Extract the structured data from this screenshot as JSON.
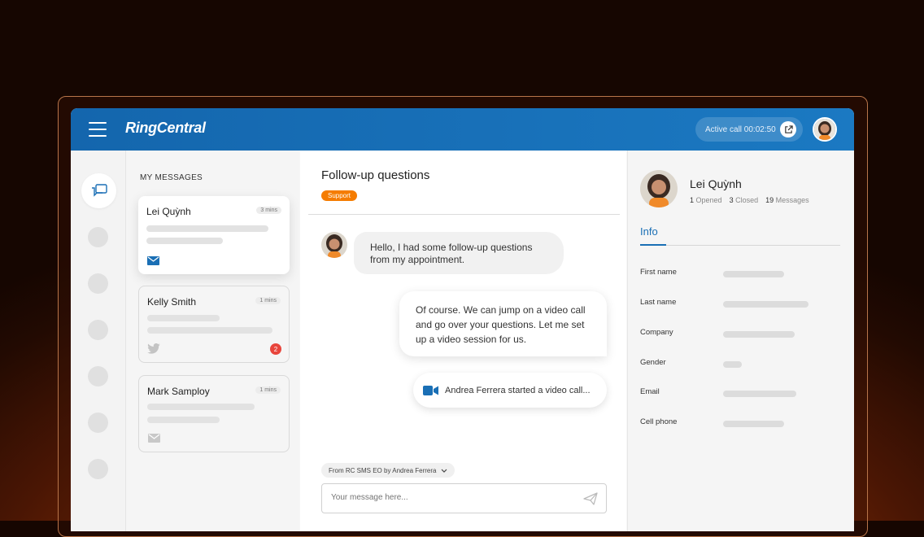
{
  "app": {
    "logo": "RingCentral",
    "active_call_label": "Active call 00:02:50"
  },
  "messages_panel": {
    "heading": "MY MESSAGES",
    "items": [
      {
        "name": "Lei Quỳnh",
        "time": "3 mins",
        "channel": "envelope-icon",
        "unread": null
      },
      {
        "name": "Kelly Smith",
        "time": "1 mins",
        "channel": "twitter-icon",
        "unread": "2"
      },
      {
        "name": "Mark Samploy",
        "time": "1 mins",
        "channel": "envelope-icon",
        "unread": null
      }
    ]
  },
  "conversation": {
    "title": "Follow-up questions",
    "tag": "Support",
    "incoming": "Hello, I had some follow-up questions from my appointment.",
    "outgoing": "Of course. We can jump on a video call and go over your questions. Let me set up a video session for us.",
    "video_event": "Andrea Ferrera started a video call...",
    "from_selector": "From RC SMS EO by Andrea Ferrera",
    "composer_placeholder": "Your message here..."
  },
  "contact": {
    "name": "Lei Quỳnh",
    "opened_count": "1",
    "opened_label": "Opened",
    "closed_count": "3",
    "closed_label": "Closed",
    "messages_count": "19",
    "messages_label": "Messages",
    "tab": "Info",
    "fields": [
      "First name",
      "Last name",
      "Company",
      "Gender",
      "Email",
      "Cell phone"
    ]
  },
  "colors": {
    "brand_blue": "#1570b8",
    "tag_orange": "#f57c00",
    "badge_red": "#e8453c"
  }
}
